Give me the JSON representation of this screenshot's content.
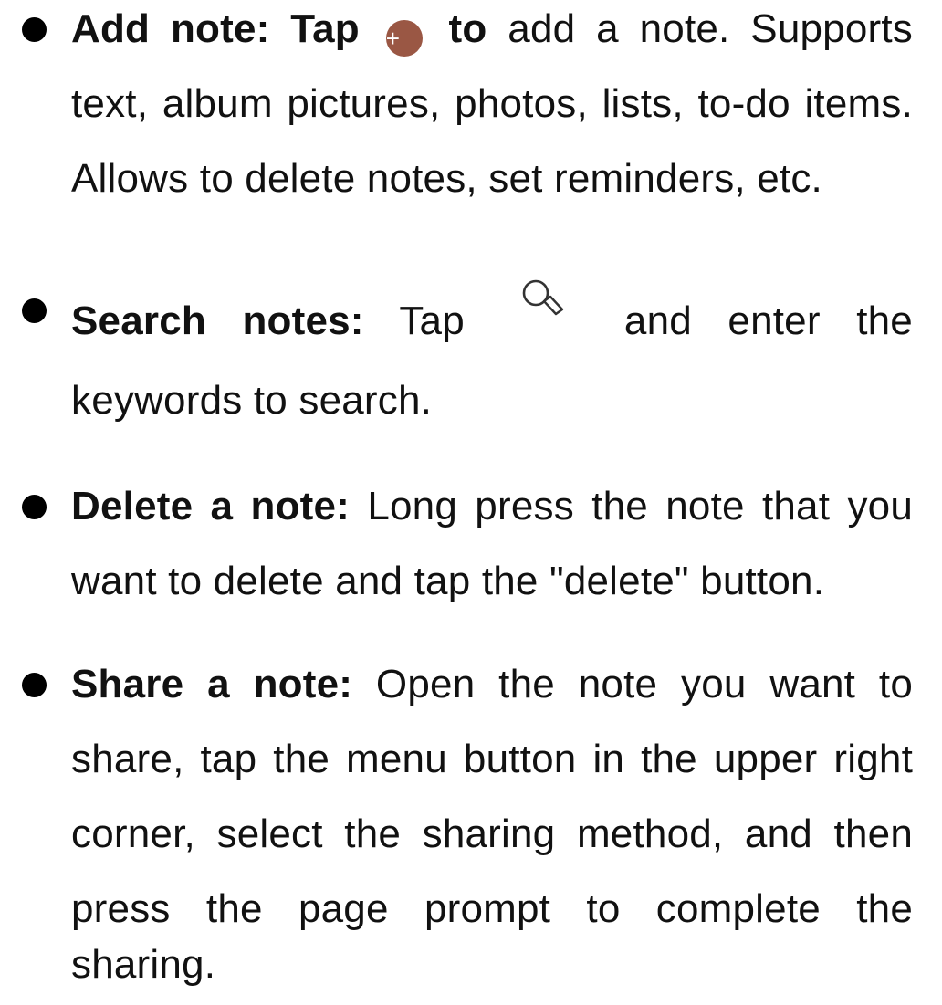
{
  "items": [
    {
      "label": "Add note: Tap",
      "label_suffix": "to",
      "lines": [
        "add a note. Supports",
        "text, album pictures, photos, lists, to-do items.",
        "Allows to delete notes, set reminders, etc."
      ],
      "icon": "add-circle-icon",
      "icon_glyph": "+",
      "icon_color": "#9a5744"
    },
    {
      "label": "Search notes:",
      "lines": [
        "Tap",
        "and enter the",
        "keywords to search."
      ],
      "icon": "search-icon"
    },
    {
      "label": "Delete a note:",
      "lines": [
        "Long press the note that you",
        "want to delete and tap the \"delete\" button."
      ]
    },
    {
      "label": "Share a note:",
      "lines": [
        "Open the note you want to",
        "share, tap the menu button in the upper right",
        "corner, select the sharing method, and then",
        "press the page prompt to complete the",
        "sharing."
      ]
    }
  ]
}
